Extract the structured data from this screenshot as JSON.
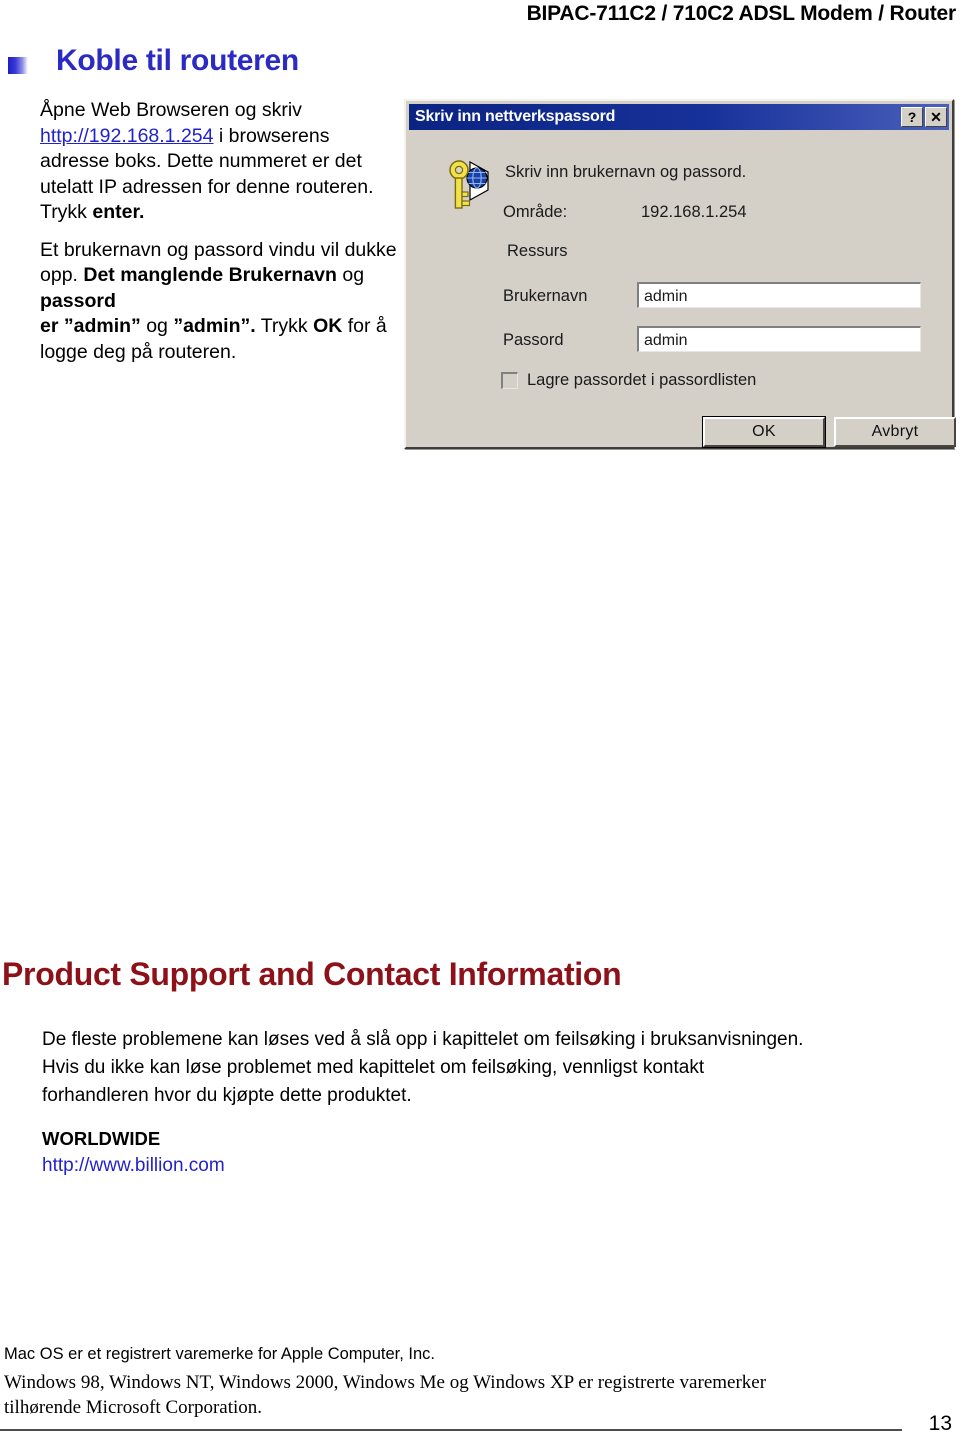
{
  "header": {
    "product_title": "BIPAC-711C2 / 710C2  ADSL Modem / Router"
  },
  "section": {
    "bullet_icon": "gradient-square-bullet",
    "title": "Koble til routeren",
    "title_color": "#2b2bc4"
  },
  "instructions": {
    "para1_before_link": "Åpne Web Browseren og skriv ",
    "link_text": "http://192.168.1.254",
    "para1_after_link": " i browserens adresse boks. Dette nummeret er det utelatt IP adressen for denne routeren. Trykk ",
    "para1_bold_tail": "enter.",
    "para2_a": "Et brukernavn og passord vindu vil dukke opp. ",
    "para2_b_bold": "Det manglende Brukernavn",
    "para2_c": " og ",
    "para2_d_bold": "passord",
    "para2_e_bold": "er ”admin”",
    "para2_f": " og ",
    "para2_g_bold": "”admin”.",
    "para2_h": " Trykk ",
    "para2_i_bold": "OK",
    "para2_j": " for å logge deg på routeren."
  },
  "dialog": {
    "title": "Skriv inn nettverkspassord",
    "help_button": "?",
    "close_button": "✕",
    "icon": "key-and-globe-icon",
    "prompt": "Skriv inn brukernavn og passord.",
    "area_label": "Område:",
    "area_value": "192.168.1.254",
    "resource_label": "Ressurs",
    "username_label": "Brukernavn",
    "username_value": "admin",
    "password_label": "Passord",
    "password_value": "admin",
    "save_checkbox_label": "Lagre passordet i passordlisten",
    "save_checkbox_checked": false,
    "ok_button": "OK",
    "cancel_button": "Avbryt",
    "titlebar_color": "#17319a",
    "face_color": "#d4d0c8"
  },
  "support": {
    "title": "Product Support and Contact Information",
    "title_color": "#8c1118",
    "body_line1": "De fleste problemene kan løses ved å slå opp i kapittelet om feilsøking i bruksanvisningen.",
    "body_line2": "Hvis du ikke kan løse problemet med kapittelet om feilsøking,  vennligst kontakt",
    "body_line3": "forhandleren hvor du kjøpte dette produktet.",
    "worldwide_label": "WORLDWIDE",
    "worldwide_url": "http://www.billion.com"
  },
  "footer": {
    "mac_notice": "Mac OS er et registrert varemerke for Apple Computer, Inc.",
    "windows_notice_line1": "Windows 98, Windows NT, Windows 2000, Windows Me og Windows XP er registrerte varemerker",
    "windows_notice_line2": "tilhørende Microsoft Corporation.",
    "page_number": "13"
  }
}
